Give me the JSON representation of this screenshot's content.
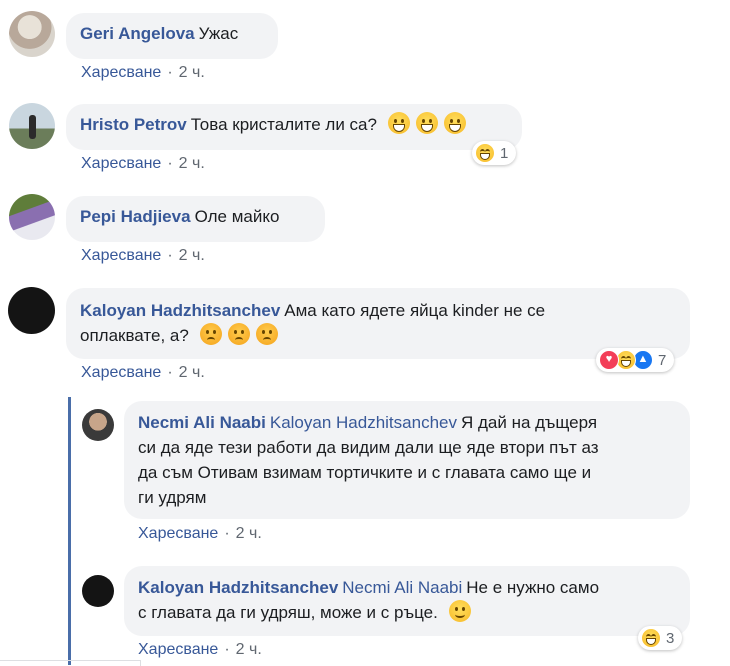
{
  "comments": [
    {
      "author": "Geri Angelova",
      "text": "Ужас",
      "like_label": "Харесване",
      "separator": "·",
      "time": "2 ч.",
      "avatar": "photo-avatar"
    },
    {
      "author": "Hristo Petrov",
      "text": "Това кристалите ли са?",
      "emojis": [
        "grinning-face",
        "grinning-face",
        "grinning-face"
      ],
      "like_label": "Харесване",
      "separator": "·",
      "time": "2 ч.",
      "reactions": [
        "laughing-face"
      ],
      "reaction_count": "1",
      "avatar": "photo-avatar"
    },
    {
      "author": "Pepi Hadjieva",
      "text": "Оле майко",
      "like_label": "Харесване",
      "separator": "·",
      "time": "2 ч.",
      "avatar": "photo-avatar"
    },
    {
      "author": "Kaloyan Hadzhitsanchev",
      "text_line1": "Ама като ядете яйца kinder не се",
      "text_line2": "оплаквате, а?",
      "emojis": [
        "sad-face",
        "sad-face",
        "sad-face"
      ],
      "like_label": "Харесване",
      "separator": "·",
      "time": "2 ч.",
      "reactions": [
        "heart-icon",
        "laughing-face",
        "thumbs-up-icon"
      ],
      "reaction_count": "7",
      "avatar": "black-avatar"
    }
  ],
  "replies": [
    {
      "author": "Necmi Ali Naabi",
      "mention": "Kaloyan Hadzhitsanchev",
      "text_line1": "Я дай на дъщеря",
      "text_line2": "си да яде тези работи да видим дали ще яде втори път аз",
      "text_line3": "да съм Отивам взимам тортичките и с главата само ще и",
      "text_line4": "ги удрям",
      "like_label": "Харесване",
      "separator": "·",
      "time": "2 ч.",
      "avatar": "photo-avatar"
    },
    {
      "author": "Kaloyan Hadzhitsanchev",
      "mention": "Necmi Ali Naabi",
      "text_line1": "Не е нужно само",
      "text_line2": "с главата да ги удряш, може и с ръце.",
      "emojis": [
        "smiling-face"
      ],
      "like_label": "Харесване",
      "separator": "·",
      "time": "2 ч.",
      "reactions": [
        "laughing-face"
      ],
      "reaction_count": "3",
      "avatar": "black-avatar"
    }
  ],
  "colors": {
    "link": "#385898",
    "bubble": "#f2f3f5",
    "meta": "#606770",
    "thread_line": "#4a6ea9",
    "heart": "#f33e58",
    "like": "#1877f2"
  }
}
